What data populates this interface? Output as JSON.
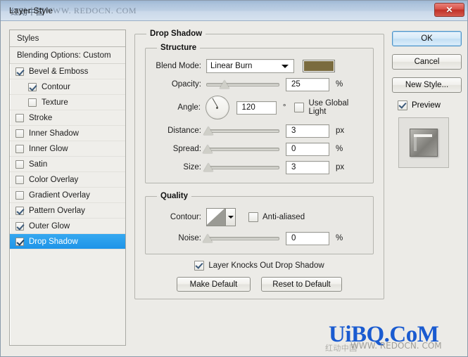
{
  "window": {
    "title": "Layer Style",
    "title_watermark_cn": "红动中国",
    "title_watermark_url": "WWW. REDOCN. COM",
    "close_label": "✕"
  },
  "styles_panel": {
    "header": "Styles",
    "blending_options": "Blending Options: Custom",
    "items": [
      {
        "label": "Bevel & Emboss",
        "checked": true,
        "indent": false,
        "selected": false
      },
      {
        "label": "Contour",
        "checked": true,
        "indent": true,
        "selected": false
      },
      {
        "label": "Texture",
        "checked": false,
        "indent": true,
        "selected": false
      },
      {
        "label": "Stroke",
        "checked": false,
        "indent": false,
        "selected": false
      },
      {
        "label": "Inner Shadow",
        "checked": false,
        "indent": false,
        "selected": false
      },
      {
        "label": "Inner Glow",
        "checked": false,
        "indent": false,
        "selected": false
      },
      {
        "label": "Satin",
        "checked": false,
        "indent": false,
        "selected": false
      },
      {
        "label": "Color Overlay",
        "checked": false,
        "indent": false,
        "selected": false
      },
      {
        "label": "Gradient Overlay",
        "checked": false,
        "indent": false,
        "selected": false
      },
      {
        "label": "Pattern Overlay",
        "checked": true,
        "indent": false,
        "selected": false
      },
      {
        "label": "Outer Glow",
        "checked": true,
        "indent": false,
        "selected": false
      },
      {
        "label": "Drop Shadow",
        "checked": true,
        "indent": false,
        "selected": true
      }
    ]
  },
  "drop_shadow": {
    "group_title": "Drop Shadow",
    "structure": {
      "title": "Structure",
      "blend_mode_label": "Blend Mode:",
      "blend_mode_value": "Linear Burn",
      "color_swatch": "#7a6b3f",
      "opacity_label": "Opacity:",
      "opacity_value": "25",
      "opacity_unit": "%",
      "angle_label": "Angle:",
      "angle_value": "120",
      "angle_unit": "°",
      "use_global_light_label": "Use Global Light",
      "use_global_light_checked": false,
      "distance_label": "Distance:",
      "distance_value": "3",
      "distance_unit": "px",
      "spread_label": "Spread:",
      "spread_value": "0",
      "spread_unit": "%",
      "size_label": "Size:",
      "size_value": "3",
      "size_unit": "px"
    },
    "quality": {
      "title": "Quality",
      "contour_label": "Contour:",
      "anti_aliased_label": "Anti-aliased",
      "anti_aliased_checked": false,
      "noise_label": "Noise:",
      "noise_value": "0",
      "noise_unit": "%"
    },
    "knockout_label": "Layer Knocks Out Drop Shadow",
    "knockout_checked": true,
    "make_default": "Make Default",
    "reset_to_default": "Reset to Default"
  },
  "right_panel": {
    "ok": "OK",
    "cancel": "Cancel",
    "new_style": "New Style...",
    "preview_label": "Preview",
    "preview_checked": true
  },
  "watermarks": {
    "main": "UiBQ.CoM",
    "sub_cn": "红动中国",
    "sub_url": "WWW. REDOCN. COM"
  }
}
